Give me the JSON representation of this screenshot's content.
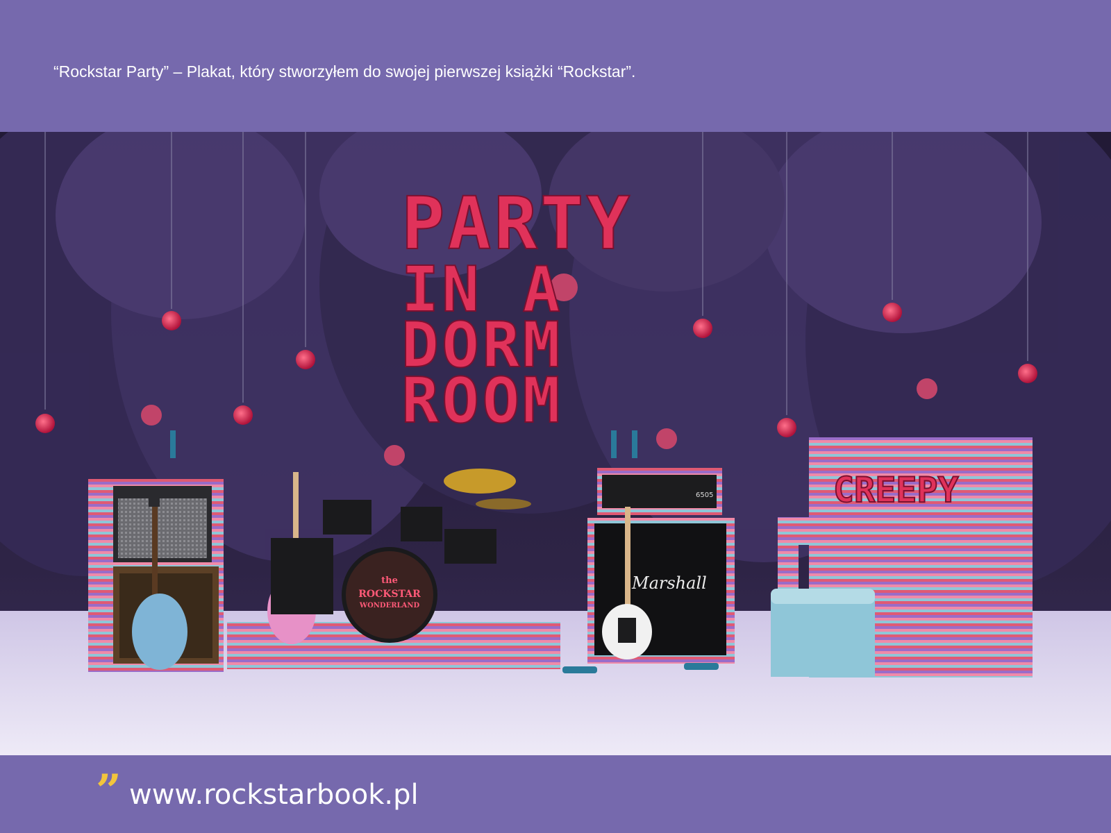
{
  "header": {
    "caption": "“Rockstar Party” – Plakat, który stworzyłem do swojej pierwszej książki “Rockstar”."
  },
  "poster": {
    "title_lines": [
      "PARTY",
      "IN A",
      "DORM",
      "ROOM"
    ],
    "drum_text": {
      "line1": "the",
      "line2": "ROCKSTAR",
      "line3": "WONDERLAND"
    },
    "amp_brand": "Marshall",
    "amp_model": "6505",
    "piano_sign": "CREEPY"
  },
  "footer": {
    "quote_mark": "”",
    "url": "www.rockstarbook.pl"
  },
  "colors": {
    "band": "#7669ad",
    "neon": "#e0325a",
    "quote": "#f3c53c"
  }
}
